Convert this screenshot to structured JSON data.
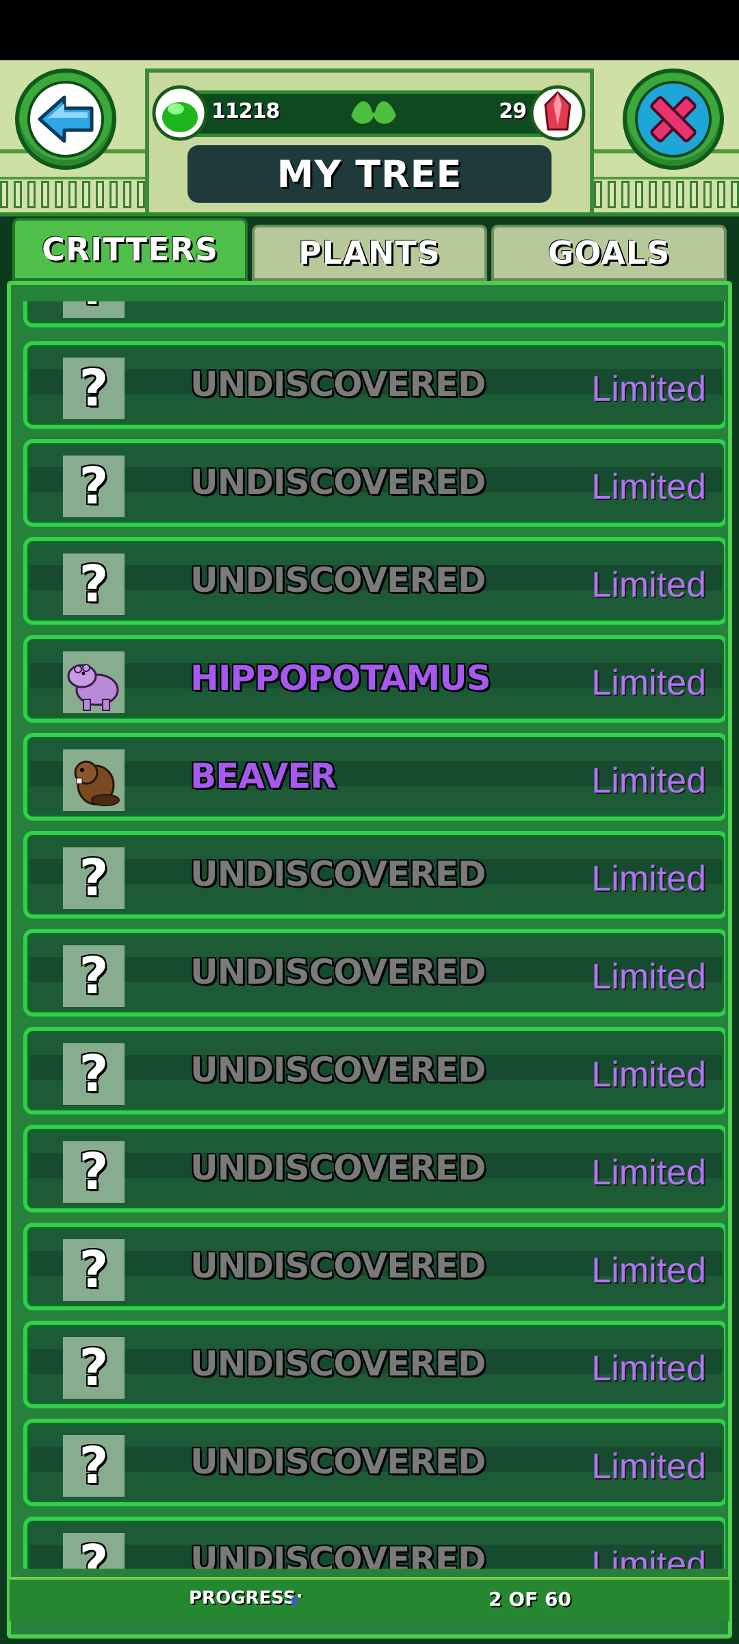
{
  "header": {
    "title": "MY TREE",
    "green_currency": "11218",
    "gem_currency": "29"
  },
  "tabs": [
    {
      "label": "CRITTERS",
      "active": true
    },
    {
      "label": "PLANTS",
      "active": false
    },
    {
      "label": "GOALS",
      "active": false
    }
  ],
  "rows": [
    {
      "name": "UNDISCOVERED",
      "status": "Limited",
      "discovered": false,
      "icon": "question-mark-icon"
    },
    {
      "name": "UNDISCOVERED",
      "status": "Limited",
      "discovered": false,
      "icon": "question-mark-icon"
    },
    {
      "name": "UNDISCOVERED",
      "status": "Limited",
      "discovered": false,
      "icon": "question-mark-icon"
    },
    {
      "name": "HIPPOPOTAMUS",
      "status": "Limited",
      "discovered": true,
      "icon": "hippopotamus-icon"
    },
    {
      "name": "BEAVER",
      "status": "Limited",
      "discovered": true,
      "icon": "beaver-icon"
    },
    {
      "name": "UNDISCOVERED",
      "status": "Limited",
      "discovered": false,
      "icon": "question-mark-icon"
    },
    {
      "name": "UNDISCOVERED",
      "status": "Limited",
      "discovered": false,
      "icon": "question-mark-icon"
    },
    {
      "name": "UNDISCOVERED",
      "status": "Limited",
      "discovered": false,
      "icon": "question-mark-icon"
    },
    {
      "name": "UNDISCOVERED",
      "status": "Limited",
      "discovered": false,
      "icon": "question-mark-icon"
    },
    {
      "name": "UNDISCOVERED",
      "status": "Limited",
      "discovered": false,
      "icon": "question-mark-icon"
    },
    {
      "name": "UNDISCOVERED",
      "status": "Limited",
      "discovered": false,
      "icon": "question-mark-icon"
    },
    {
      "name": "UNDISCOVERED",
      "status": "Limited",
      "discovered": false,
      "icon": "question-mark-icon"
    },
    {
      "name": "UNDISCOVERED",
      "status": "Limited",
      "discovered": false,
      "icon": "question-mark-icon"
    }
  ],
  "progress": {
    "label": "PROGRESS:",
    "text": "2 OF 60",
    "fraction": 0.0333
  },
  "colors": {
    "discovered_name": "#a659ee",
    "undiscovered_name": "#7a7a7a",
    "limited": "#b175f2"
  }
}
